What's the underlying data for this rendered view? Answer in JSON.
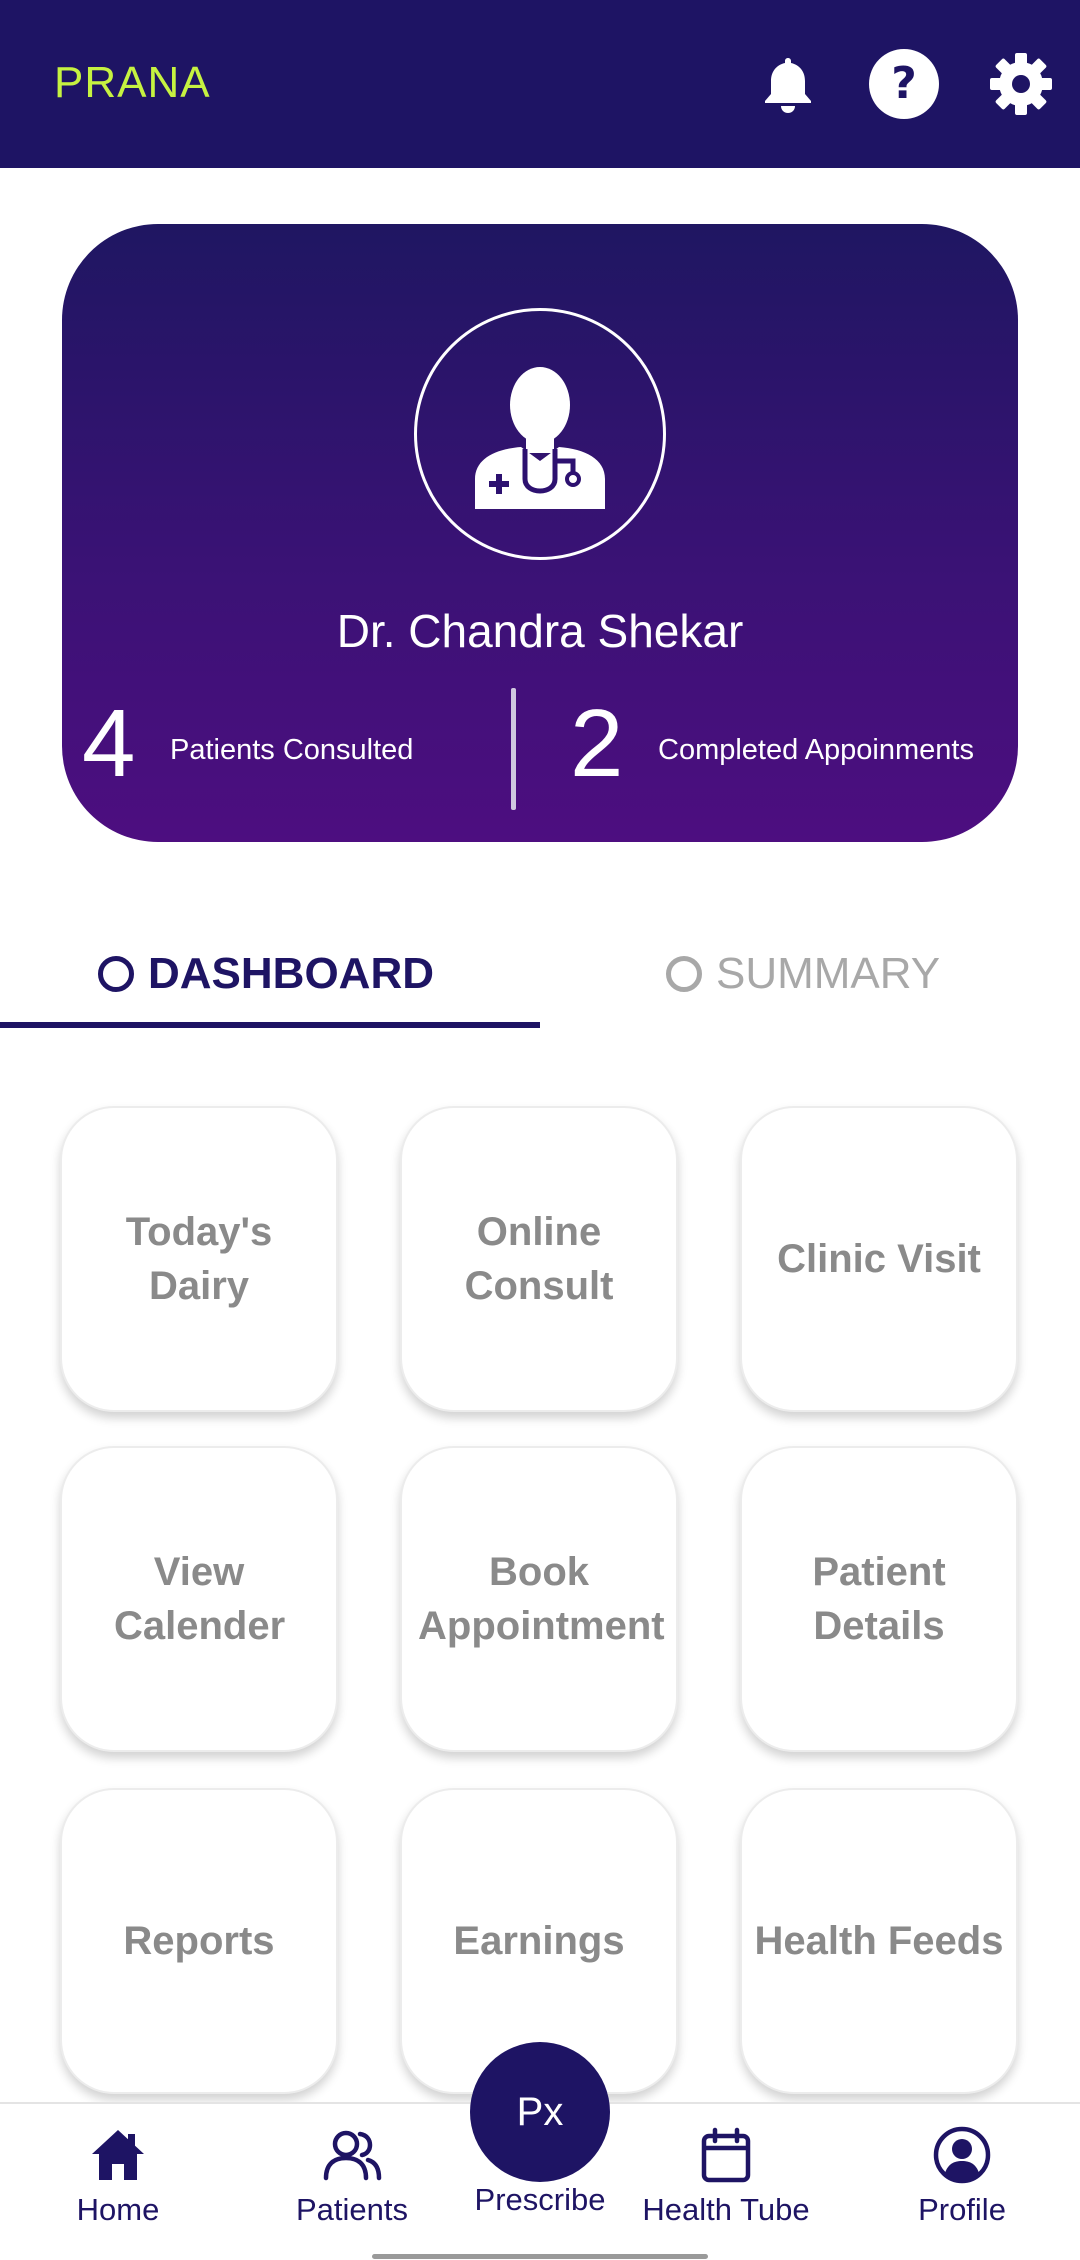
{
  "app": {
    "title": "PRANA",
    "brand_color": "#1e1464",
    "accent_color": "#c6f241"
  },
  "header": {
    "icons": [
      "bell-icon",
      "help-icon",
      "gear-icon"
    ]
  },
  "profile": {
    "avatar_icon": "doctor-icon",
    "name": "Dr. Chandra Shekar",
    "stats": [
      {
        "value": "4",
        "label": "Patients Consulted"
      },
      {
        "value": "2",
        "label": "Completed Appoinments"
      }
    ]
  },
  "tabs": [
    {
      "label": "DASHBOARD",
      "active": true
    },
    {
      "label": "SUMMARY",
      "active": false
    }
  ],
  "tiles": [
    {
      "label": "Today's Dairy"
    },
    {
      "label": "Online Consult"
    },
    {
      "label": "Clinic Visit"
    },
    {
      "label": "View Calender"
    },
    {
      "label": "Book Appointment"
    },
    {
      "label": "Patient Details"
    },
    {
      "label": "Reports"
    },
    {
      "label": "Earnings"
    },
    {
      "label": "Health Feeds"
    }
  ],
  "bottom_nav": {
    "items": [
      {
        "label": "Home",
        "icon": "home-icon"
      },
      {
        "label": "Patients",
        "icon": "users-icon"
      },
      {
        "label": "Prescribe",
        "icon": "prescribe-fab",
        "fab_text": "Px"
      },
      {
        "label": "Health Tube",
        "icon": "calendar-icon"
      },
      {
        "label": "Profile",
        "icon": "profile-icon"
      }
    ]
  }
}
